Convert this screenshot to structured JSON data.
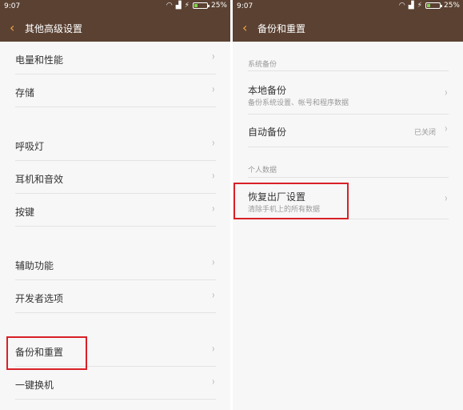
{
  "status": {
    "time": "9:07",
    "battery": "25%"
  },
  "left": {
    "title": "其他高级设置",
    "items": [
      {
        "label": "电量和性能"
      },
      {
        "label": "存储"
      },
      {
        "label": "呼吸灯"
      },
      {
        "label": "耳机和音效"
      },
      {
        "label": "按键"
      },
      {
        "label": "辅助功能"
      },
      {
        "label": "开发者选项"
      },
      {
        "label": "备份和重置"
      },
      {
        "label": "一键换机"
      }
    ]
  },
  "right": {
    "title": "备份和重置",
    "section1": "系统备份",
    "local_backup": {
      "label": "本地备份",
      "sub": "备份系统设置、帐号和程序数据"
    },
    "auto_backup": {
      "label": "自动备份",
      "value": "已关闭"
    },
    "section2": "个人数据",
    "factory_reset": {
      "label": "恢复出厂设置",
      "sub": "清除手机上的所有数据"
    }
  },
  "colors": {
    "header_bg": "#5a4132",
    "accent": "#f3a640",
    "highlight": "#d92027"
  }
}
